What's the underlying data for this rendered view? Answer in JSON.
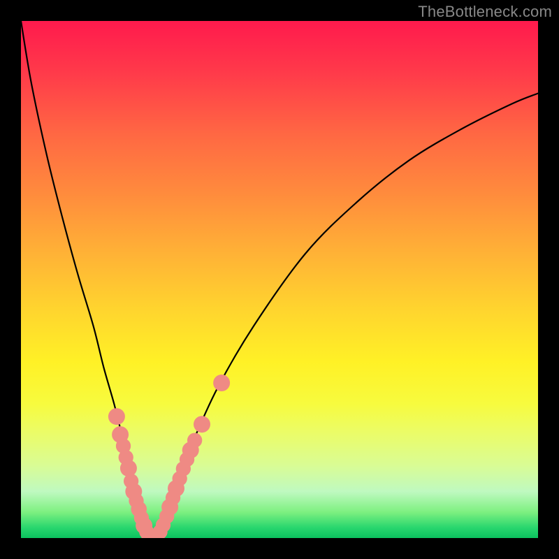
{
  "watermark": {
    "text": "TheBottleneck.com"
  },
  "colors": {
    "curve_stroke": "#000000",
    "marker_fill": "#ef8a84",
    "page_bg": "#000000"
  },
  "chart_data": {
    "type": "line",
    "title": "",
    "xlabel": "",
    "ylabel": "",
    "xlim": [
      0,
      100
    ],
    "ylim": [
      0,
      100
    ],
    "grid": false,
    "gradient_background": {
      "top": "#ff1a4d",
      "middle": "#fff126",
      "bottom": "#0cc25f"
    },
    "series": [
      {
        "name": "bottleneck-curve",
        "x": [
          0,
          2,
          5,
          8,
          11,
          14,
          16,
          18,
          19.5,
          21,
          22,
          23,
          24,
          25,
          26,
          27,
          28,
          30,
          33,
          38,
          45,
          55,
          65,
          75,
          85,
          95,
          100
        ],
        "y": [
          100,
          88,
          74,
          62,
          51,
          41,
          33,
          26,
          20,
          14,
          9,
          5,
          2,
          0,
          0,
          2,
          5,
          10,
          18,
          29,
          41,
          55,
          65,
          73,
          79,
          84,
          86
        ]
      }
    ],
    "annotations": [
      {
        "name": "markers-left-cluster",
        "points": [
          {
            "x": 18.5,
            "y": 23.5,
            "r": 1.2
          },
          {
            "x": 19.2,
            "y": 20.0,
            "r": 1.2
          },
          {
            "x": 19.8,
            "y": 17.8,
            "r": 1.0
          },
          {
            "x": 20.3,
            "y": 15.6,
            "r": 1.0
          },
          {
            "x": 20.8,
            "y": 13.5,
            "r": 1.2
          },
          {
            "x": 21.3,
            "y": 11.0,
            "r": 1.0
          },
          {
            "x": 21.8,
            "y": 9.0,
            "r": 1.2
          },
          {
            "x": 22.3,
            "y": 7.2,
            "r": 1.0
          },
          {
            "x": 22.8,
            "y": 5.6,
            "r": 1.1
          },
          {
            "x": 23.3,
            "y": 3.9,
            "r": 1.0
          },
          {
            "x": 23.8,
            "y": 2.4,
            "r": 1.2
          },
          {
            "x": 24.3,
            "y": 1.2,
            "r": 1.0
          }
        ]
      },
      {
        "name": "markers-valley",
        "points": [
          {
            "x": 24.8,
            "y": 0.4,
            "r": 1.1
          },
          {
            "x": 25.5,
            "y": 0.1,
            "r": 1.1
          },
          {
            "x": 26.2,
            "y": 0.3,
            "r": 1.1
          },
          {
            "x": 26.9,
            "y": 1.2,
            "r": 1.0
          },
          {
            "x": 27.5,
            "y": 2.5,
            "r": 1.0
          }
        ]
      },
      {
        "name": "markers-right-cluster",
        "points": [
          {
            "x": 28.2,
            "y": 4.2,
            "r": 1.0
          },
          {
            "x": 28.8,
            "y": 6.0,
            "r": 1.2
          },
          {
            "x": 29.4,
            "y": 7.8,
            "r": 1.0
          },
          {
            "x": 30.0,
            "y": 9.6,
            "r": 1.2
          },
          {
            "x": 30.7,
            "y": 11.5,
            "r": 1.0
          },
          {
            "x": 31.4,
            "y": 13.4,
            "r": 1.0
          },
          {
            "x": 32.1,
            "y": 15.2,
            "r": 1.0
          },
          {
            "x": 32.8,
            "y": 17.0,
            "r": 1.2
          },
          {
            "x": 33.6,
            "y": 18.9,
            "r": 1.0
          },
          {
            "x": 35.0,
            "y": 22.0,
            "r": 1.2
          },
          {
            "x": 38.8,
            "y": 30.0,
            "r": 1.2
          }
        ]
      }
    ]
  }
}
